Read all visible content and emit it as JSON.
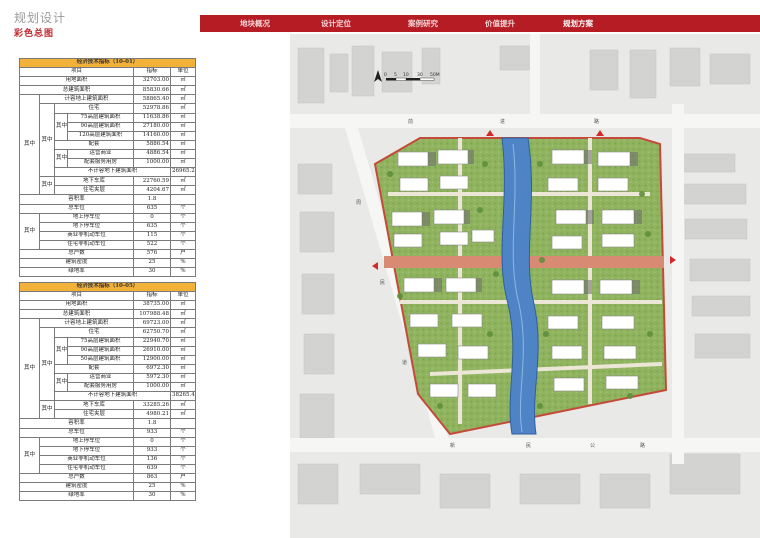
{
  "header": {
    "title": "规划设计",
    "subtitle": "彩色总图"
  },
  "nav": {
    "items": [
      "地块概况",
      "设计定位",
      "案例研究",
      "价值提升",
      "规划方案"
    ],
    "active": "规划方案"
  },
  "colors": {
    "brand_red": "#b51c24",
    "table_header": "#f2b138"
  },
  "table1": {
    "title": "经济技术指标（10-01）",
    "header": [
      "项目",
      "指标",
      "单位"
    ],
    "other": "其中",
    "rows": [
      {
        "label": "用地面积",
        "value": "32703.00",
        "unit": "㎡"
      },
      {
        "label": "总建筑面积",
        "value": "85830.66",
        "unit": "㎡"
      },
      {
        "label": "计容地上建筑面积",
        "value": "58865.40",
        "unit": "㎡"
      },
      {
        "label": "住宅",
        "value": "52978.86",
        "unit": "㎡"
      },
      {
        "label": "75高层建筑面积",
        "value": "11638.86",
        "unit": "㎡"
      },
      {
        "label": "90高层建筑面积",
        "value": "27180.00",
        "unit": "㎡"
      },
      {
        "label": "120高层建筑面积",
        "value": "14160.00",
        "unit": "㎡"
      },
      {
        "label": "配套",
        "value": "5886.54",
        "unit": "㎡"
      },
      {
        "label": "运营商业",
        "value": "4886.54",
        "unit": "㎡"
      },
      {
        "label": "配套服务用房",
        "value": "1000.00",
        "unit": "㎡"
      },
      {
        "label": "不计容地下建筑面积",
        "value": "26965.26",
        "unit": "㎡"
      },
      {
        "label": "地下车库",
        "value": "22760.59",
        "unit": "㎡"
      },
      {
        "label": "住宅夹层",
        "value": "4204.67",
        "unit": "㎡"
      },
      {
        "label": "容积率",
        "value": "1.8",
        "unit": ""
      },
      {
        "label": "总车位",
        "value": "635",
        "unit": "个"
      },
      {
        "label": "地上停车位",
        "value": "0",
        "unit": "个"
      },
      {
        "label": "地下停车位",
        "value": "635",
        "unit": "个"
      },
      {
        "label": "商业非机动车位",
        "value": "115",
        "unit": "个"
      },
      {
        "label": "住宅非机动车位",
        "value": "522",
        "unit": "个"
      },
      {
        "label": "总户数",
        "value": "576",
        "unit": "户"
      },
      {
        "label": "建筑密度",
        "value": "25",
        "unit": "%"
      },
      {
        "label": "绿地率",
        "value": "30",
        "unit": "%"
      }
    ]
  },
  "table2": {
    "title": "经济技术指标（10-05）",
    "header": [
      "项目",
      "指标",
      "单位"
    ],
    "other": "其中",
    "rows": [
      {
        "label": "用地面积",
        "value": "38735.00",
        "unit": "㎡"
      },
      {
        "label": "总建筑面积",
        "value": "107988.48",
        "unit": "㎡"
      },
      {
        "label": "计容地上建筑面积",
        "value": "69723.00",
        "unit": "㎡"
      },
      {
        "label": "住宅",
        "value": "62750.70",
        "unit": "㎡"
      },
      {
        "label": "75高层建筑面积",
        "value": "22940.70",
        "unit": "㎡"
      },
      {
        "label": "90高层建筑面积",
        "value": "26910.00",
        "unit": "㎡"
      },
      {
        "label": "50高层建筑面积",
        "value": "12900.00",
        "unit": "㎡"
      },
      {
        "label": "配套",
        "value": "6972.30",
        "unit": "㎡"
      },
      {
        "label": "运营商业",
        "value": "5972.30",
        "unit": "㎡"
      },
      {
        "label": "配套服务用房",
        "value": "1000.00",
        "unit": "㎡"
      },
      {
        "label": "不计容地下建筑面积",
        "value": "38265.48",
        "unit": "㎡"
      },
      {
        "label": "地下车库",
        "value": "33285.26",
        "unit": "㎡"
      },
      {
        "label": "住宅夹层",
        "value": "4980.21",
        "unit": "㎡"
      },
      {
        "label": "容积率",
        "value": "1.8",
        "unit": ""
      },
      {
        "label": "总车位",
        "value": "933",
        "unit": "个"
      },
      {
        "label": "地上停车位",
        "value": "0",
        "unit": "个"
      },
      {
        "label": "地下停车位",
        "value": "933",
        "unit": "个"
      },
      {
        "label": "商业非机动车位",
        "value": "136",
        "unit": "个"
      },
      {
        "label": "住宅非机动车位",
        "value": "639",
        "unit": "个"
      },
      {
        "label": "总户数",
        "value": "863",
        "unit": "户"
      },
      {
        "label": "建筑密度",
        "value": "25",
        "unit": "%"
      },
      {
        "label": "绿地率",
        "value": "30",
        "unit": "%"
      }
    ]
  },
  "map": {
    "scale_labels": [
      "0",
      "5",
      "10",
      "30",
      "50M"
    ],
    "road_labels": [
      "前",
      "进",
      "路",
      "周",
      "民",
      "道",
      "新",
      "民",
      "公",
      "路"
    ]
  }
}
